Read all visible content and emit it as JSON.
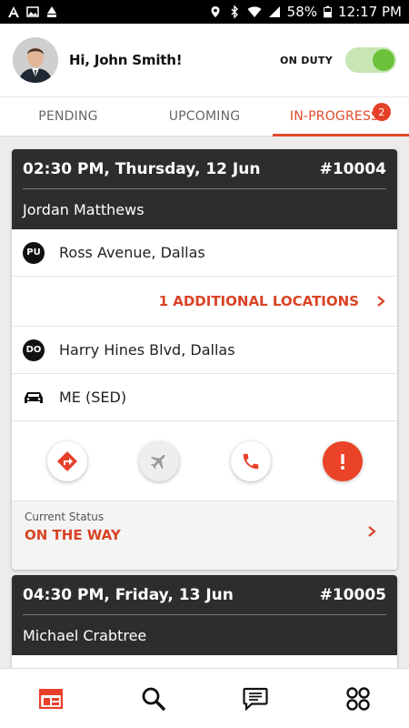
{
  "status_bar": {
    "battery": "58%",
    "time": "12:17 PM"
  },
  "header": {
    "greeting": "Hi, John Smith!",
    "duty_label": "ON DUTY",
    "duty_on": true
  },
  "tabs": [
    {
      "label": "PENDING",
      "active": false
    },
    {
      "label": "UPCOMING",
      "active": false
    },
    {
      "label": "IN-PROGRESS",
      "active": true,
      "badge": "2"
    }
  ],
  "trips": [
    {
      "datetime": "02:30 PM, Thursday, 12 Jun",
      "number": "#10004",
      "passenger": "Jordan Matthews",
      "pickup_tag": "PU",
      "pickup": "Ross Avenue, Dallas",
      "additional": "1 ADDITIONAL LOCATIONS",
      "dropoff_tag": "DO",
      "dropoff": "Harry Hines Blvd, Dallas",
      "vehicle": "ME (SED)",
      "status_label": "Current Status",
      "status_value": "ON THE WAY"
    },
    {
      "datetime": "04:30 PM, Friday, 13 Jun",
      "number": "#10005",
      "passenger": "Michael Crabtree"
    }
  ],
  "colors": {
    "accent": "#e04a2a",
    "dark": "#2d2d2d",
    "toggle": "#6cc13a"
  },
  "icons": {
    "nav": [
      "dashboard-icon",
      "search-icon",
      "chat-icon",
      "apps-icon"
    ],
    "actions": [
      "directions-icon",
      "flight-icon",
      "phone-icon",
      "alert-icon"
    ]
  }
}
